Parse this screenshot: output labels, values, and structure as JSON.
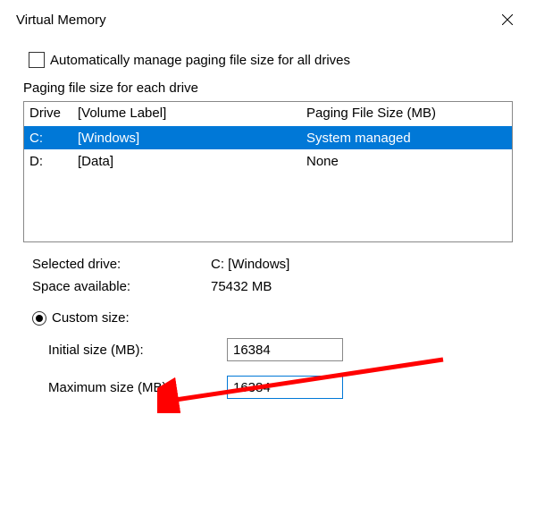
{
  "window": {
    "title": "Virtual Memory"
  },
  "checkbox": {
    "auto_manage_label": "Automatically manage paging file size for all drives",
    "checked": false
  },
  "section_label": "Paging file size for each drive",
  "drive_header": {
    "drive": "Drive",
    "volume": "[Volume Label]",
    "size": "Paging File Size (MB)"
  },
  "drives": [
    {
      "letter": "C:",
      "label": "[Windows]",
      "size": "System managed",
      "selected": true
    },
    {
      "letter": "D:",
      "label": "[Data]",
      "size": "None",
      "selected": false
    }
  ],
  "info": {
    "selected_drive_label": "Selected drive:",
    "selected_drive_value": "C:  [Windows]",
    "space_available_label": "Space available:",
    "space_available_value": "75432 MB"
  },
  "custom_size": {
    "radio_label": "Custom size:",
    "selected": true,
    "initial_label": "Initial size (MB):",
    "initial_value": "16384",
    "maximum_label": "Maximum size (MB):",
    "maximum_value": "16384"
  },
  "annotation": {
    "arrow_color": "#ff0000"
  }
}
